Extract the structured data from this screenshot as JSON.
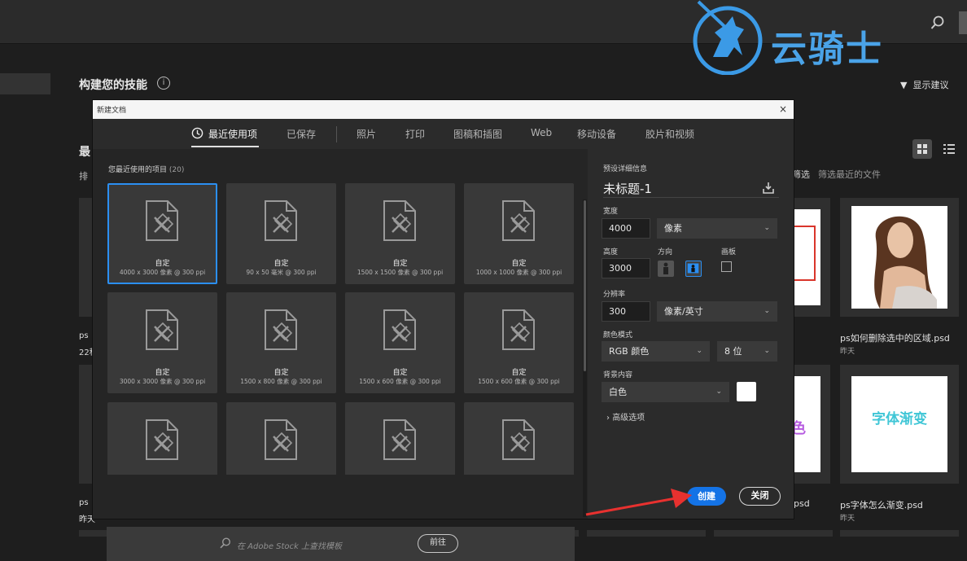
{
  "home": {
    "title": "构建您的技能",
    "show_suggestions": "显示建议",
    "recent_heading": "最",
    "sort_label": "排",
    "filter_label": "筛选",
    "filter_placeholder": "筛选最近的文件",
    "left_files": [
      {
        "name": "ps",
        "date": "22秒"
      },
      {
        "name": "ps",
        "date": "昨天"
      }
    ],
    "right_files": [
      {
        "name": "ps如何删除选中的区域.psd",
        "date": "昨天"
      },
      {
        "name": "ps字体怎么渐变.psd",
        "date": "昨天"
      }
    ],
    "middle_file_suffix": "psd",
    "gradient_text": "字体渐变",
    "partial_text": "色"
  },
  "dialog": {
    "title": "新建文档",
    "close": "×",
    "tabs": [
      "最近使用项",
      "已保存",
      "照片",
      "打印",
      "图稿和插图",
      "Web",
      "移动设备",
      "胶片和视频"
    ],
    "recent_label": "您最近使用的项目",
    "recent_count": "(20)",
    "presets": [
      {
        "name": "自定",
        "desc": "4000 x 3000 像素 @ 300 ppi",
        "selected": true
      },
      {
        "name": "自定",
        "desc": "90 x 50 毫米 @ 300 ppi"
      },
      {
        "name": "自定",
        "desc": "1500 x 1500 像素 @ 300 ppi"
      },
      {
        "name": "自定",
        "desc": "1000 x 1000 像素 @ 300 ppi"
      },
      {
        "name": "自定",
        "desc": "3000 x 3000 像素 @ 300 ppi"
      },
      {
        "name": "自定",
        "desc": "1500 x 800 像素 @ 300 ppi"
      },
      {
        "name": "自定",
        "desc": "1500 x 600 像素 @ 300 ppi"
      },
      {
        "name": "自定",
        "desc": "1500 x 600 像素 @ 300 ppi"
      },
      {
        "name": "",
        "desc": ""
      },
      {
        "name": "",
        "desc": ""
      },
      {
        "name": "",
        "desc": ""
      },
      {
        "name": "",
        "desc": ""
      }
    ],
    "stock_placeholder": "在 Adobe Stock 上查找模板",
    "stock_go": "前往",
    "details": {
      "section_label": "预设详细信息",
      "doc_name": "未标题-1",
      "width_label": "宽度",
      "width_value": "4000",
      "width_unit": "像素",
      "height_label": "高度",
      "height_value": "3000",
      "orientation_label": "方向",
      "artboard_label": "画板",
      "resolution_label": "分辨率",
      "resolution_value": "300",
      "resolution_unit": "像素/英寸",
      "color_mode_label": "颜色模式",
      "color_mode": "RGB 颜色",
      "bit_depth": "8 位",
      "bg_label": "背景内容",
      "bg_value": "白色",
      "advanced": "高级选项",
      "create": "创建",
      "close": "关闭"
    }
  },
  "watermark": {
    "text": "云骑士"
  },
  "colors": {
    "accent": "#1473e6",
    "watermark": "#4aa3e8",
    "arrow": "#e8312f"
  }
}
